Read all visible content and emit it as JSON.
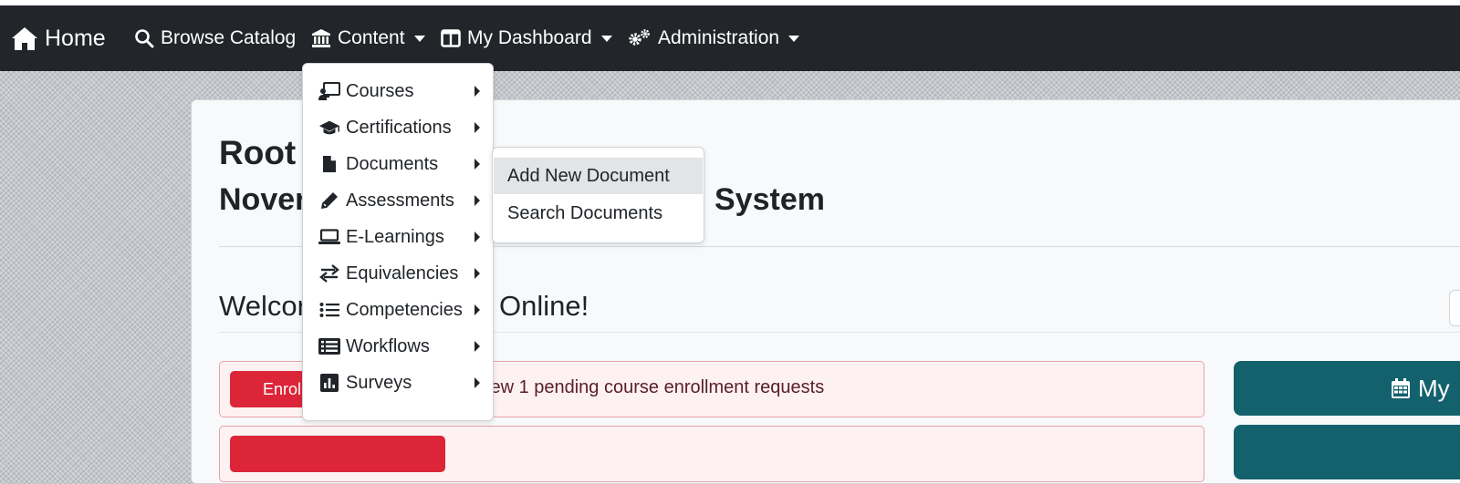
{
  "navbar": {
    "home": "Home",
    "browse_catalog": "Browse Catalog",
    "content": "Content",
    "my_dashboard": "My Dashboard",
    "administration": "Administration"
  },
  "content_menu": {
    "items": [
      {
        "label": "Courses",
        "icon": "chalkboard-teacher-icon"
      },
      {
        "label": "Certifications",
        "icon": "graduation-cap-icon"
      },
      {
        "label": "Documents",
        "icon": "file-icon"
      },
      {
        "label": "Assessments",
        "icon": "pencil-icon"
      },
      {
        "label": "E-Learnings",
        "icon": "laptop-icon"
      },
      {
        "label": "Equivalencies",
        "icon": "exchange-icon"
      },
      {
        "label": "Competencies",
        "icon": "list-icon"
      },
      {
        "label": "Workflows",
        "icon": "list-alt-icon"
      },
      {
        "label": "Surveys",
        "icon": "poll-icon"
      }
    ]
  },
  "documents_submenu": {
    "items": [
      {
        "label": "Add New Document"
      },
      {
        "label": "Search Documents"
      }
    ]
  },
  "main": {
    "title": "Root",
    "subtitle_start": "Nover",
    "subtitle_end": "System",
    "welcome_start": "Welcor",
    "welcome_end": "Online!",
    "alert_button": "Enroll",
    "alert_text": "iew 1 pending course enrollment requests",
    "side_button": "My"
  },
  "colors": {
    "navbar": "#222529",
    "alert_button": "#dc2538",
    "side_button": "#14616e"
  }
}
